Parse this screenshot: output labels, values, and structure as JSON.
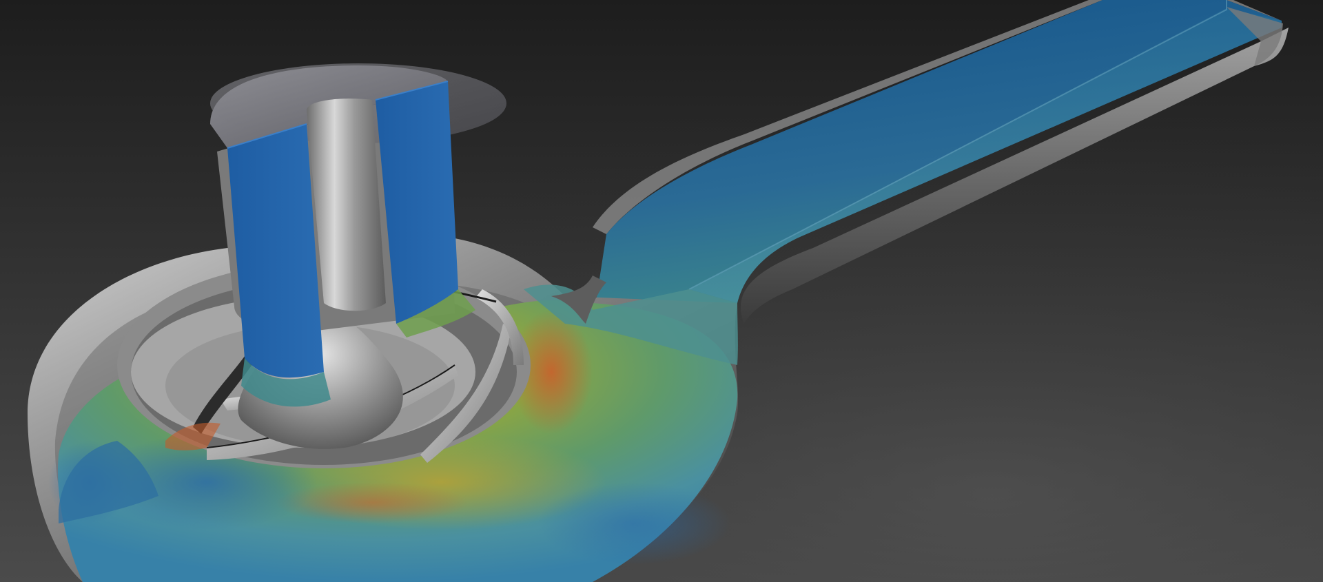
{
  "scene": {
    "subject": "impeller-volute-flow-cutaway",
    "background_color_top": "#1c1c1c",
    "background_color_bottom": "#4a4a4a",
    "solid_color": "#9a9a9a",
    "colormap": [
      "#1a4f8f",
      "#2f7fae",
      "#4a9a8c",
      "#7aa64a",
      "#a8a43a",
      "#c9822e",
      "#c0502a"
    ]
  }
}
